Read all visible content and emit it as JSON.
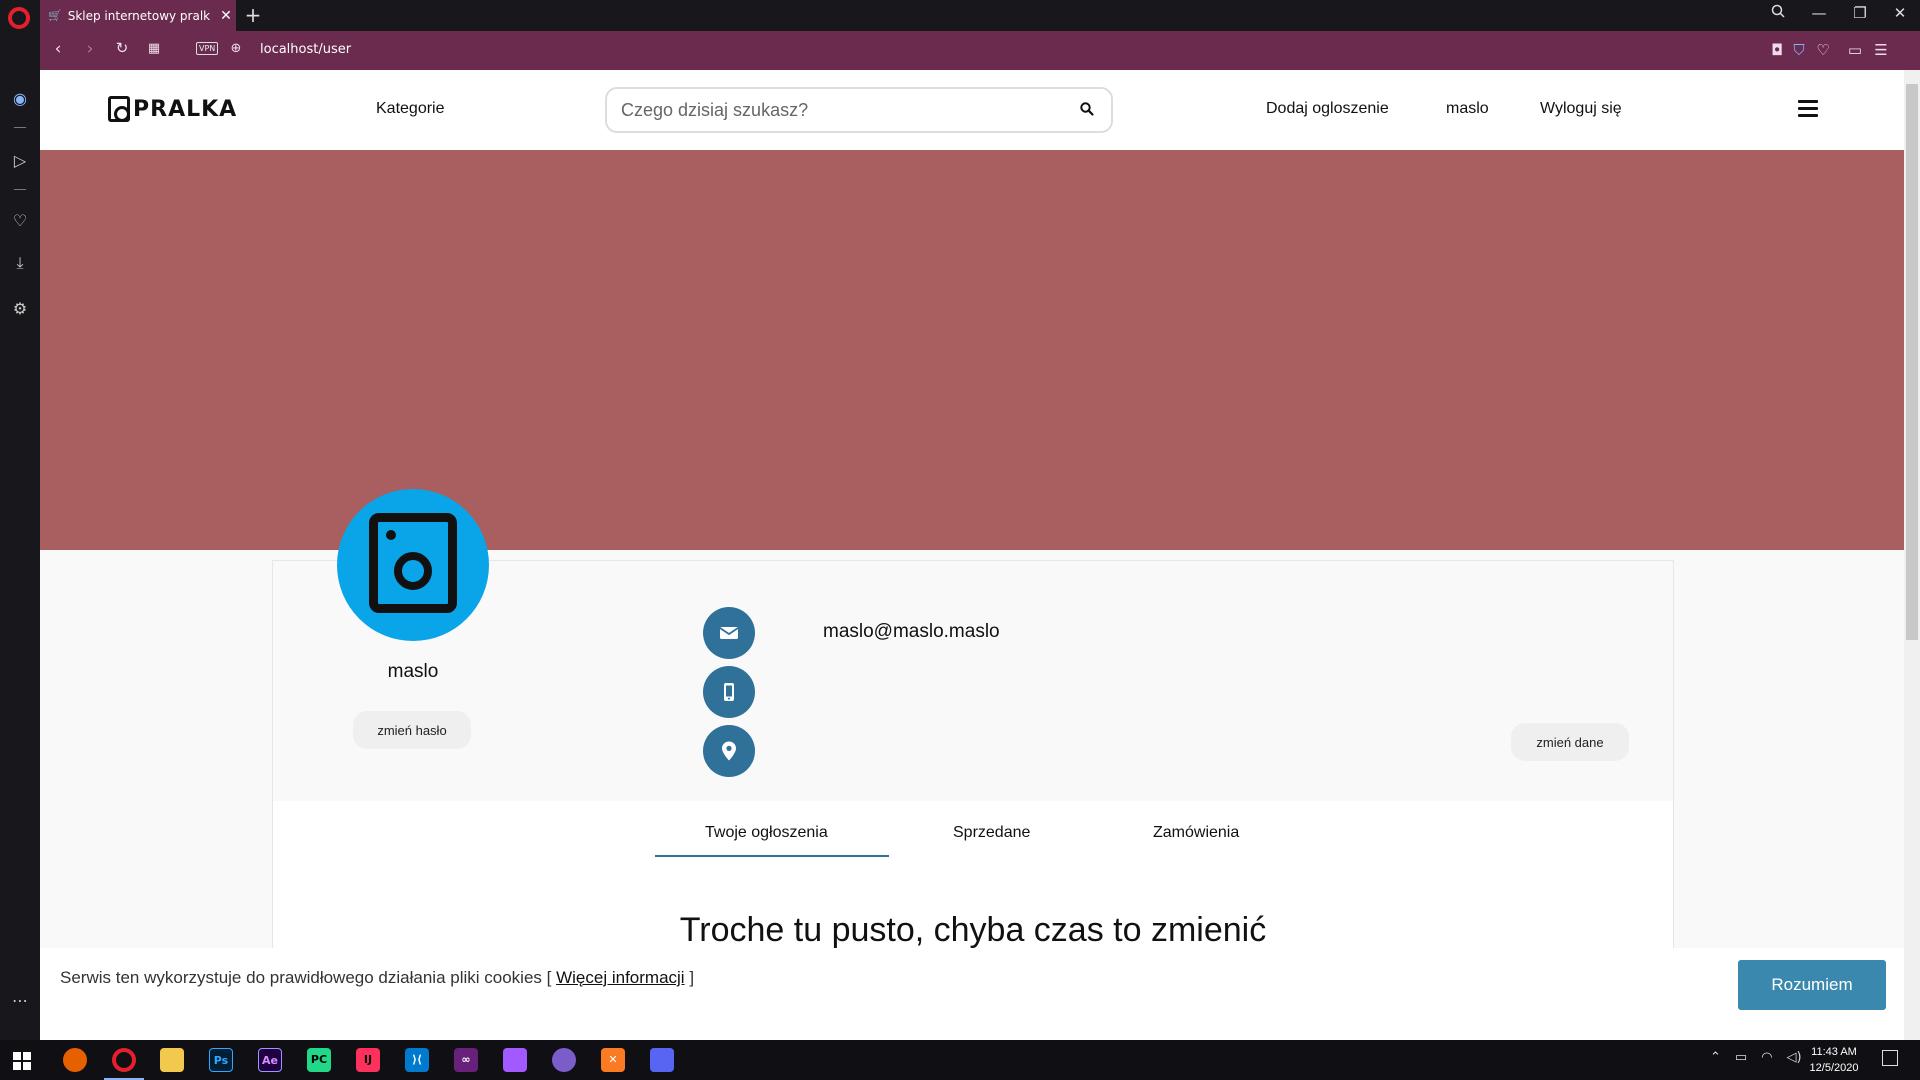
{
  "browser": {
    "tab_title": "Sklep internetowy pralka",
    "tab_close": "✕",
    "new_tab": "+",
    "url": "localhost/user",
    "vpn_label": "VPN"
  },
  "header": {
    "logo_text": "PRALKA",
    "categories": "Kategorie",
    "search_placeholder": "Czego dzisiaj szukasz?",
    "add_listing": "Dodaj ogloszenie",
    "username": "maslo",
    "logout": "Wyloguj się"
  },
  "profile": {
    "username": "maslo",
    "change_password": "zmień hasło",
    "email": "maslo@maslo.maslo",
    "change_data": "zmień dane",
    "colors": {
      "avatar_bg": "#0aa5e9",
      "banner": "#a95f5f",
      "accent": "#2f7199"
    }
  },
  "tabs": [
    {
      "label": "Twoje ogłoszenia",
      "active": true
    },
    {
      "label": "Sprzedane",
      "active": false
    },
    {
      "label": "Zamówienia",
      "active": false
    }
  ],
  "empty_message": "Troche tu pusto, chyba czas to zmienić",
  "cookie": {
    "text": "Serwis ten wykorzystuje do prawidłowego działania pliki cookies",
    "bracket_open": "[",
    "link": "Więcej informacji",
    "bracket_close": "]",
    "accept": "Rozumiem"
  },
  "taskbar": {
    "time": "11:43 AM",
    "date": "12/5/2020",
    "apps": [
      "firefox-icon",
      "opera-icon",
      "file-explorer-icon",
      "photoshop-icon",
      "after-effects-icon",
      "pycharm-icon",
      "intellij-icon",
      "vscode-icon",
      "visual-studio-icon",
      "figma-icon",
      "app-icon",
      "xampp-icon",
      "discord-icon"
    ]
  }
}
